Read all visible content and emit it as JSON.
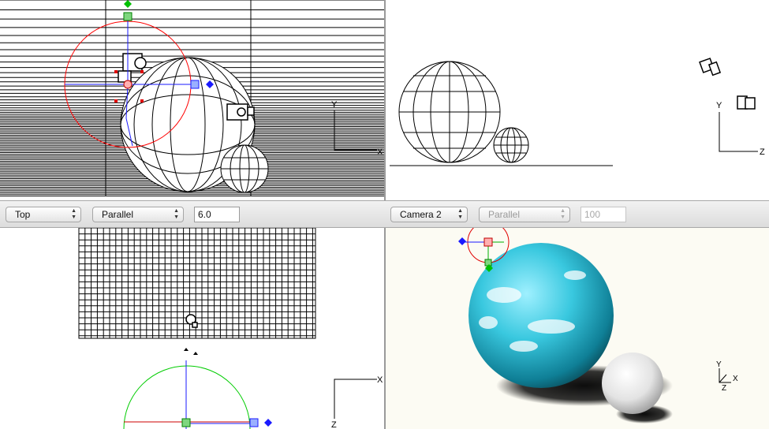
{
  "toolbar_left": {
    "view_select": "Top",
    "projection_select": "Parallel",
    "zoom_value": "6.0"
  },
  "toolbar_right": {
    "view_select": "Camera 2",
    "projection_select": "Parallel",
    "zoom_value": "100"
  },
  "axis_labels": {
    "x": "X",
    "y": "Y",
    "z": "Z"
  },
  "colors": {
    "x_axis": "#1a1aff",
    "y_axis": "#00b000",
    "selection_circle": "#ff0000",
    "planet": "#39c8df",
    "moon": "#e9e9e9"
  }
}
